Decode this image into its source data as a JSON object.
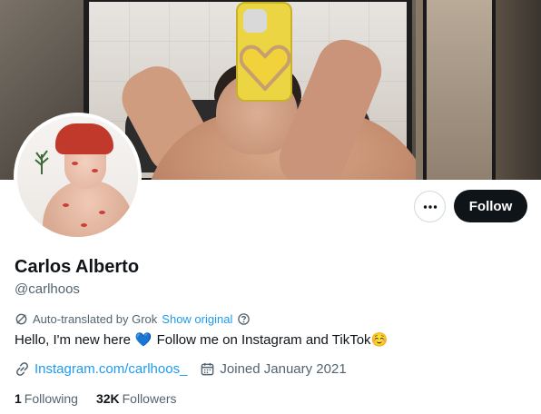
{
  "profile": {
    "display_name": "Carlos Alberto",
    "handle": "@carlhoos",
    "translation_note": "Auto-translated by Grok",
    "show_original_label": "Show original",
    "bio_part1": "Hello, I'm new here",
    "bio_heart": "💙",
    "bio_part2": "Follow me on Instagram and TikTok",
    "bio_emoji": "☺️",
    "website": "Instagram.com/carlhoos_",
    "joined": "Joined January 2021",
    "following_count": "1",
    "following_label": "Following",
    "followers_count": "32K",
    "followers_label": "Followers"
  },
  "actions": {
    "follow_label": "Follow",
    "more_icon": "more-horizontal-icon"
  },
  "icons": {
    "translate": "translate-icon",
    "help": "help-circle-icon",
    "link": "link-icon",
    "calendar": "calendar-icon"
  },
  "colors": {
    "accent": "#1d9bf0",
    "text_primary": "#0f1419",
    "text_secondary": "#536471",
    "follow_button_bg": "#0f1419"
  }
}
